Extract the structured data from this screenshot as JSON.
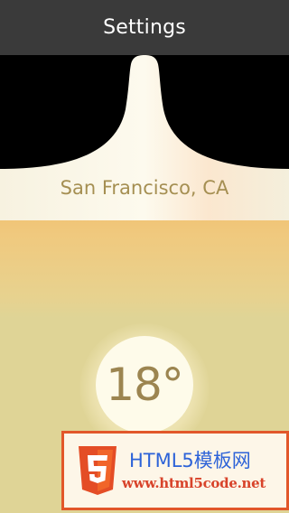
{
  "header": {
    "title": "Settings"
  },
  "weather": {
    "city": "San Francisco, CA",
    "temperature": "18°"
  },
  "watermark": {
    "title": "HTML5模板网",
    "url": "www.html5code.net",
    "logo_icon": "html5-shield-icon"
  },
  "colors": {
    "header_bg": "#3a3a3a",
    "drip_fill": "#fbf7e8",
    "city_text": "#a58f52",
    "temp_text": "#9c8550",
    "sky_top": "#e68a10",
    "watermark_border": "#e2572a",
    "watermark_title": "#2d63d8",
    "watermark_url": "#d8432a"
  }
}
